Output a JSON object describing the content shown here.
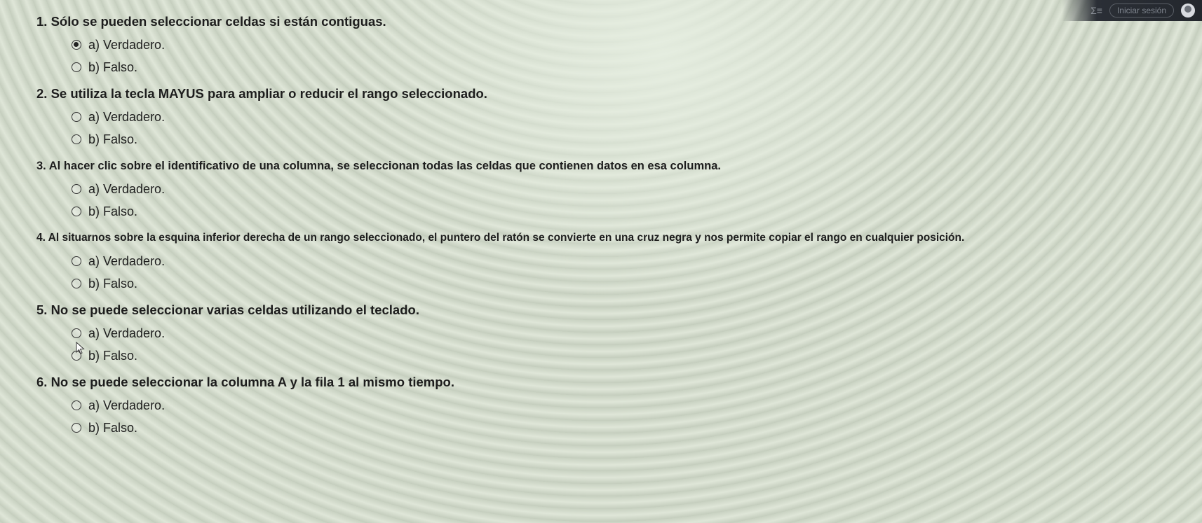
{
  "topbar": {
    "sigma_icon": "sigma-icon",
    "signin_label": "Iniciar sesión",
    "avatar_icon": "user-avatar-icon"
  },
  "questions": [
    {
      "text": "1. Sólo se pueden seleccionar celdas si están contiguas.",
      "options": [
        {
          "label": "a) Verdadero.",
          "selected": true
        },
        {
          "label": "b) Falso.",
          "selected": false
        }
      ]
    },
    {
      "text": "2. Se utiliza la tecla MAYUS para ampliar o reducir el rango seleccionado.",
      "options": [
        {
          "label": "a) Verdadero.",
          "selected": false
        },
        {
          "label": "b) Falso.",
          "selected": false
        }
      ]
    },
    {
      "text": "3. Al hacer clic sobre el identificativo de una columna, se seleccionan todas las celdas que contienen datos en esa columna.",
      "options": [
        {
          "label": "a) Verdadero.",
          "selected": false
        },
        {
          "label": "b) Falso.",
          "selected": false
        }
      ]
    },
    {
      "text": "4. Al situarnos sobre la esquina inferior derecha de un rango seleccionado, el puntero del ratón se convierte en una cruz negra y nos permite copiar el rango en cualquier posición.",
      "options": [
        {
          "label": "a) Verdadero.",
          "selected": false
        },
        {
          "label": "b) Falso.",
          "selected": false
        }
      ]
    },
    {
      "text": "5. No se puede seleccionar varias celdas utilizando el teclado.",
      "options": [
        {
          "label": "a) Verdadero.",
          "selected": false
        },
        {
          "label": "b) Falso.",
          "selected": false
        }
      ]
    },
    {
      "text": "6. No se puede seleccionar la columna A y la fila 1 al mismo tiempo.",
      "options": [
        {
          "label": "a) Verdadero.",
          "selected": false
        },
        {
          "label": "b) Falso.",
          "selected": false
        }
      ]
    }
  ],
  "mouse_cursor_icon": "mouse-pointer-icon"
}
